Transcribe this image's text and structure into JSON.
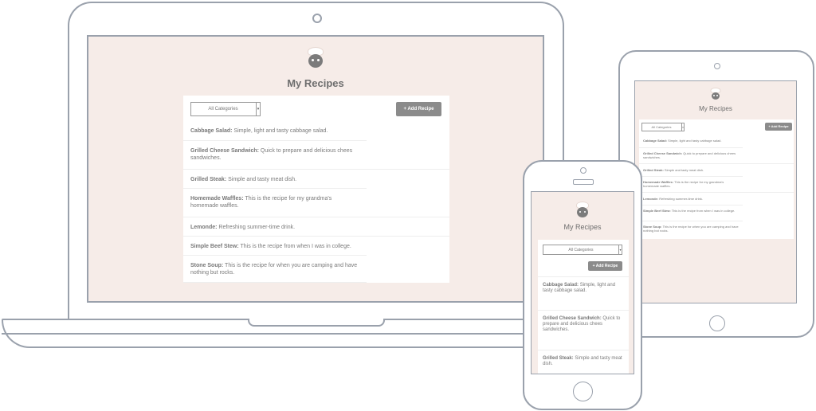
{
  "app": {
    "title": "My Recipes",
    "category_select": "All Categories",
    "add_button": "+ Add Recipe"
  },
  "recipes": [
    {
      "name": "Cabbage Salad:",
      "desc": "Simple, light and tasty cabbage salad."
    },
    {
      "name": "Grilled Cheese Sandwich:",
      "desc": "Quick to prepare and delicious chees sandwiches."
    },
    {
      "name": "Grilled Steak:",
      "desc": "Simple and tasty meat dish."
    },
    {
      "name": "Homemade Waffles:",
      "desc": "This is the recipe for my grandma's homemade waffles."
    },
    {
      "name": "Lemonde:",
      "desc": "Refreshing summer-time drink."
    },
    {
      "name": "Simple Beef Stew:",
      "desc": "This is the recipe from when I was in college."
    },
    {
      "name": "Stone Soup:",
      "desc": "This is the recipe for when you are camping and have nothing but rocks."
    }
  ],
  "colors": {
    "screen_bg": "#f6ece8",
    "device_outline": "#9aa1ac",
    "button": "#8b8b8b"
  },
  "icons": {
    "logo": "chef-icon"
  }
}
